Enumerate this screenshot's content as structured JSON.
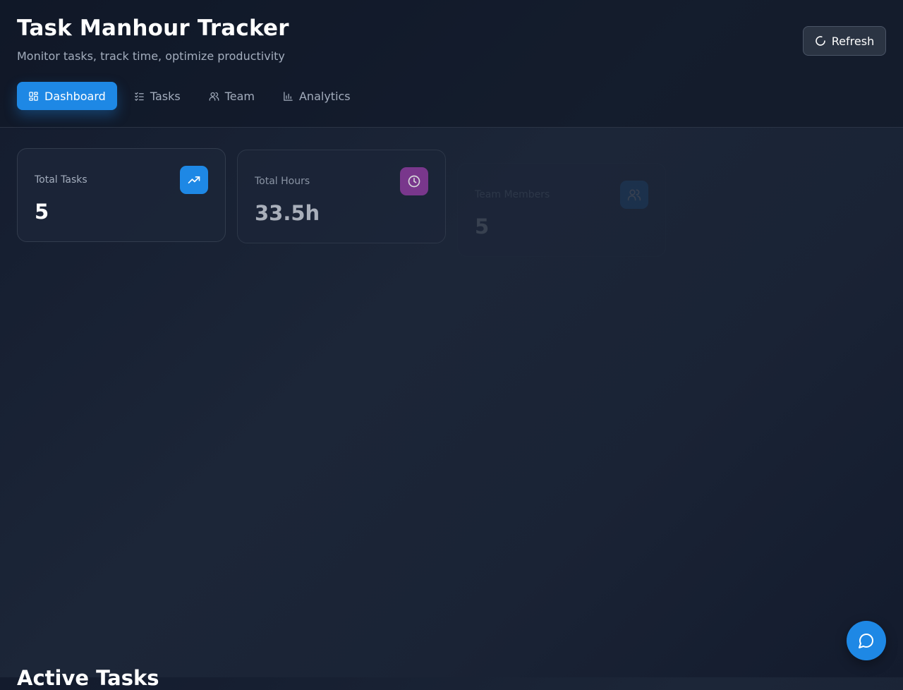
{
  "header": {
    "title": "Task Manhour Tracker",
    "subtitle": "Monitor tasks, track time, optimize productivity",
    "refresh_label": "Refresh",
    "refresh_icon": "refresh-icon"
  },
  "nav": {
    "tabs": [
      {
        "label": "Dashboard",
        "icon": "dashboard-icon",
        "active": true
      },
      {
        "label": "Tasks",
        "icon": "list-check-icon",
        "active": false
      },
      {
        "label": "Team",
        "icon": "users-icon",
        "active": false
      },
      {
        "label": "Analytics",
        "icon": "bar-chart-icon",
        "active": false
      }
    ]
  },
  "stats": [
    {
      "label": "Total Tasks",
      "value": "5",
      "icon": "trending-up-icon",
      "color": "#1e88e5"
    },
    {
      "label": "Total Hours",
      "value": "33.5h",
      "icon": "clock-icon",
      "color": "#8e3c9f"
    },
    {
      "label": "Team Members",
      "value": "5",
      "icon": "users-icon",
      "color": "#1e88e5"
    }
  ],
  "sections": {
    "active_tasks_title": "Active Tasks"
  },
  "chat": {
    "icon": "chat-bubble-icon"
  },
  "colors": {
    "accent": "#1e88e5",
    "hours_accent": "#8e3c9f",
    "background": "#1a2335"
  }
}
